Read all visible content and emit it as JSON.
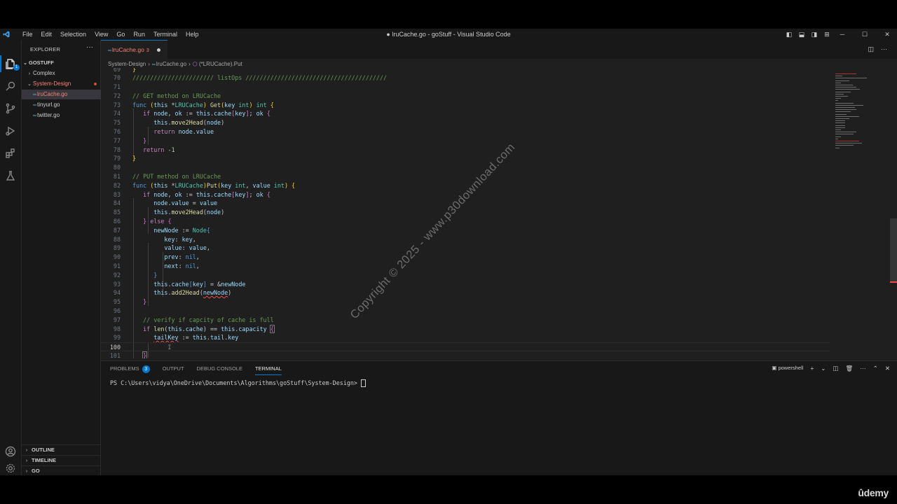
{
  "titlebar": {
    "menu": [
      "File",
      "Edit",
      "Selection",
      "View",
      "Go",
      "Run",
      "Terminal",
      "Help"
    ],
    "window_title": "● lruCache.go - goStuff - Visual Studio Code"
  },
  "activity_bar": {
    "explorer_badge": "1",
    "icons": [
      "files-icon",
      "search-icon",
      "source-control-icon",
      "run-debug-icon",
      "extensions-icon",
      "testing-icon",
      "account-icon",
      "settings-gear-icon"
    ]
  },
  "sidebar": {
    "header": "EXPLORER",
    "more": "···",
    "root": "GOSTUFF",
    "items": [
      {
        "label": "Complex",
        "kind": "folder",
        "state": "collapsed"
      },
      {
        "label": "System-Design",
        "kind": "folder",
        "state": "expanded"
      },
      {
        "label": "lruCache.go",
        "kind": "file",
        "problems": "3"
      },
      {
        "label": "tinyurl.go",
        "kind": "file"
      },
      {
        "label": "twitter.go",
        "kind": "file"
      }
    ],
    "bottom_sections": [
      "OUTLINE",
      "TIMELINE",
      "GO"
    ]
  },
  "editor": {
    "tab": {
      "label": "lruCache.go",
      "problems": "3"
    },
    "breadcrumb": [
      "System-Design",
      "lruCache.go",
      "(*LRUCache).Put"
    ],
    "current_line": "100"
  },
  "panel": {
    "tabs": [
      "PROBLEMS",
      "OUTPUT",
      "DEBUG CONSOLE",
      "TERMINAL"
    ],
    "problems_count": "3",
    "active_tab": "TERMINAL",
    "shell": "powershell",
    "prompt": "PS C:\\Users\\vidya\\OneDrive\\Documents\\Algorithms\\goStuff\\System-Design> "
  },
  "watermark": "Copyright © 2025 - www.p30download.com",
  "brand": "ûdemy",
  "colors": {
    "accent": "#0078d4",
    "error": "#f14c4c",
    "background": "#1f1f1f"
  }
}
